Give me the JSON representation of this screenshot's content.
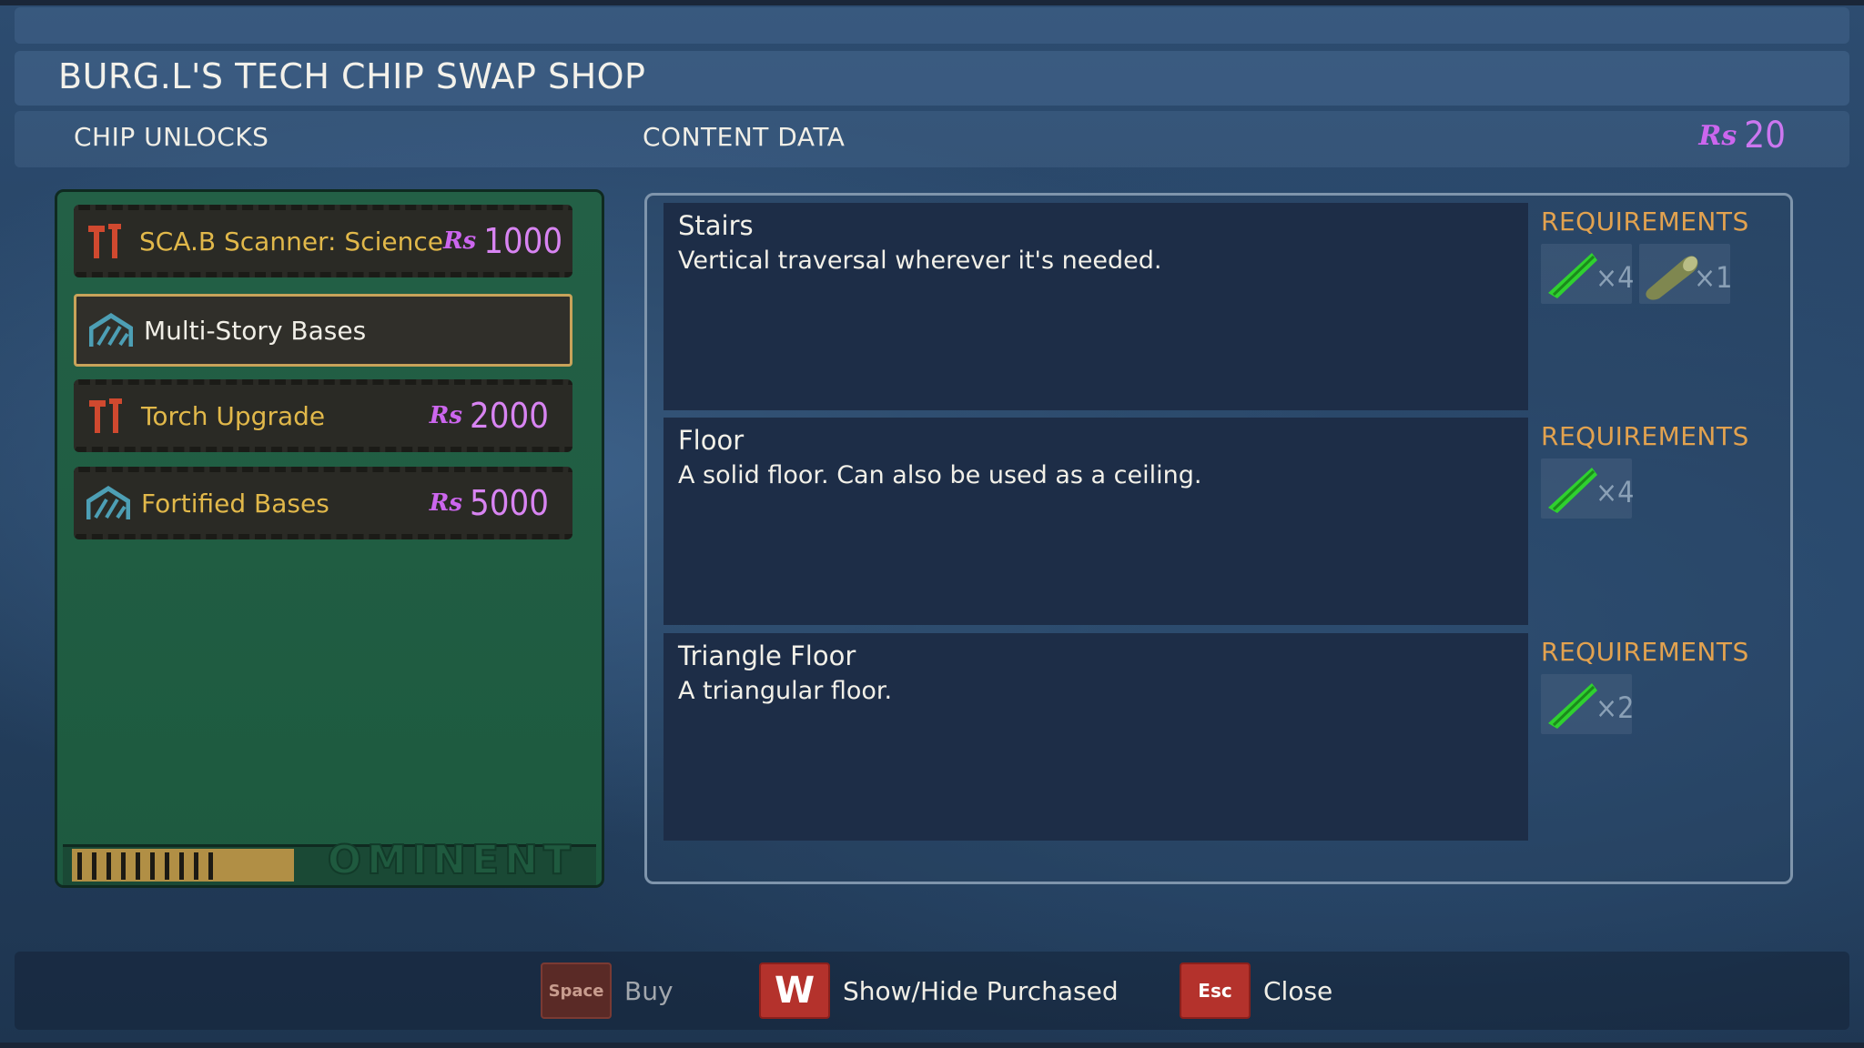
{
  "shop": {
    "title": "BURG.L'S TECH CHIP SWAP SHOP",
    "section_left": "CHIP UNLOCKS",
    "section_right": "CONTENT DATA",
    "currency_symbol": "Rs",
    "currency_amount": "20"
  },
  "chips": [
    {
      "label": "SCA.B Scanner: Science",
      "icon": "hammer-wrench-icon",
      "price": "1000",
      "selected": false
    },
    {
      "label": "Multi-Story Bases",
      "icon": "base-building-icon",
      "price": "",
      "selected": true
    },
    {
      "label": "Torch Upgrade",
      "icon": "hammer-wrench-icon",
      "price": "2000",
      "selected": false
    },
    {
      "label": "Fortified Bases",
      "icon": "base-building-icon",
      "price": "5000",
      "selected": false
    }
  ],
  "chip_board_brand": "OMINENT",
  "content": [
    {
      "name": "Stairs",
      "description": "Vertical traversal wherever it's needed.",
      "requirements_title": "REQUIREMENTS",
      "requirements": [
        {
          "icon": "grass-plank-icon",
          "count": "×4"
        },
        {
          "icon": "weed-stem-icon",
          "count": "×1"
        }
      ]
    },
    {
      "name": "Floor",
      "description": "A solid floor. Can also be used as a ceiling.",
      "requirements_title": "REQUIREMENTS",
      "requirements": [
        {
          "icon": "grass-plank-icon",
          "count": "×4"
        }
      ]
    },
    {
      "name": "Triangle Floor",
      "description": "A triangular floor.",
      "requirements_title": "REQUIREMENTS",
      "requirements": [
        {
          "icon": "grass-plank-icon",
          "count": "×2"
        }
      ]
    }
  ],
  "footer": {
    "buy_key": "Space",
    "buy_label": "Buy",
    "toggle_key": "W",
    "toggle_label": "Show/Hide Purchased",
    "close_key": "Esc",
    "close_label": "Close"
  },
  "colors": {
    "accent_gold": "#e1b84a",
    "currency_purple": "#cc77f0",
    "requirements_orange": "#e2a24f",
    "key_red": "#b4322c"
  }
}
